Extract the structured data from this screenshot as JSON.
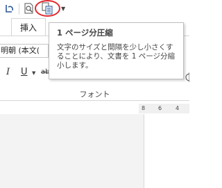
{
  "quick_access": {
    "undo_icon": "undo-icon",
    "print_preview_icon": "print-preview-icon",
    "shrink_one_page_icon": "shrink-one-page-icon",
    "customize_icon": "chevron-down-icon",
    "highlight_color": "#e0282f"
  },
  "ribbon_tabs": {
    "insert": "挿入"
  },
  "font_group": {
    "font_name": "明朝 (本文(",
    "italic_label": "I",
    "underline_label": "U",
    "strike_label": "ab",
    "label": "フォント"
  },
  "ruler": {
    "marks": [
      "8",
      "6",
      "4"
    ]
  },
  "tooltip": {
    "title": "1 ページ分圧縮",
    "description": "文字のサイズと間隔を少し小さくすることにより、文書を 1 ページ分縮小します。"
  }
}
